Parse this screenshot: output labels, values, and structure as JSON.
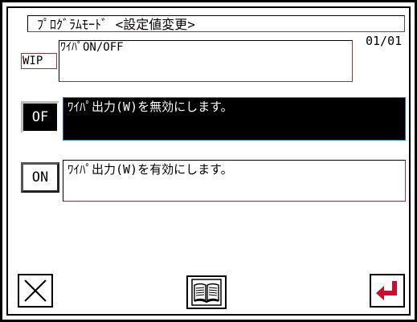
{
  "header": {
    "title": "ﾌﾟﾛｸﾞﾗﾑﾓｰﾄﾞ <設定値変更>"
  },
  "counter": "01/01",
  "parameter": {
    "code": "WIP",
    "description": "ﾜｲﾊﾟON/OFF"
  },
  "options": [
    {
      "code": "OF",
      "description": "ﾜｲﾊﾟ出力(W)を無効にします。",
      "selected": true
    },
    {
      "code": "ON",
      "description": "ﾜｲﾊﾟ出力(W)を有効にします。",
      "selected": false
    }
  ],
  "toolbar": {
    "close_icon": "close-x-icon",
    "manual_icon": "book-icon",
    "enter_icon": "enter-arrow-icon"
  },
  "colors": {
    "enter_arrow": "#c8102e",
    "selection_border": "#2a6fb0"
  }
}
